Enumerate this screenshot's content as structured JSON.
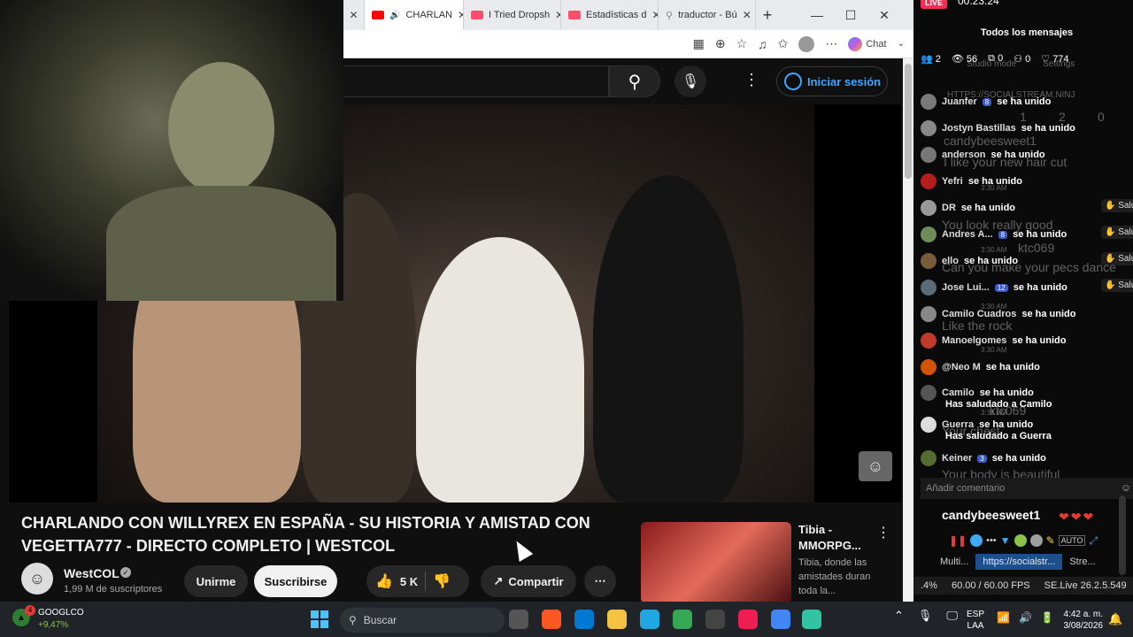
{
  "browser": {
    "tabs": [
      {
        "label": "CHARLAN",
        "color": "#ff0000",
        "active": true
      },
      {
        "label": "I Tried Dropsh",
        "color": "#ff4d6d",
        "active": false
      },
      {
        "label": "Estadísticas d",
        "color": "#ff4d6d",
        "active": false
      },
      {
        "label": "traductor - Bú",
        "color": "#9e9e9e",
        "active": false
      }
    ],
    "new_tab": "+",
    "minimize": "—",
    "maximize": "☐",
    "close": "✕",
    "chat_label": "Chat"
  },
  "youtube": {
    "login_label": "Iniciar sesión",
    "video_title": "CHARLANDO CON WILLYREX EN ESPAÑA - SU HISTORIA Y AMISTAD CON VEGETTA777 - DIRECTO COMPLETO | WESTCOL",
    "channel_name": "WestCOL",
    "subscribers": "1,99 M de suscriptores",
    "join_label": "Unirme",
    "subscribe_label": "Suscribirse",
    "likes": "5 K",
    "share_label": "Compartir",
    "recommended": {
      "title": "Tibia - MMORPG...",
      "description": "Tibia, donde las amistades duran toda la..."
    }
  },
  "tiktok": {
    "live_badge": "LIVE",
    "timer": "00:23:24",
    "header": "Todos los mensajes",
    "stats": {
      "viewers_joined": "2",
      "views": "56",
      "shares": "0",
      "followers": "0",
      "likes": "774"
    },
    "ghost_labels": [
      "Studio mode",
      "Settings"
    ],
    "messages": [
      {
        "user": "Juanfer",
        "badge": "8",
        "action": "se ha unido",
        "color": "#7a7a7a",
        "wave": false
      },
      {
        "user": "Jostyn Bastillas",
        "badge": "",
        "action": "se ha unido",
        "color": "#888",
        "wave": false
      },
      {
        "user": "anderson",
        "badge": "",
        "action": "se ha unido",
        "color": "#777",
        "wave": false
      },
      {
        "user": "Yefri",
        "badge": "",
        "action": "se ha unido",
        "color": "#b71c1c",
        "wave": false
      },
      {
        "user": "DR",
        "badge": "",
        "action": "se ha unido",
        "color": "#999",
        "wave": true
      },
      {
        "user": "Andres A...",
        "badge": "8",
        "action": "se ha unido",
        "color": "#6d8c5a",
        "wave": true
      },
      {
        "user": "ello",
        "badge": "",
        "action": "se ha unido",
        "color": "#7a5c3a",
        "wave": true
      },
      {
        "user": "Jose Lui...",
        "badge": "12",
        "action": "se ha unido",
        "color": "#5c6b7a",
        "wave": true
      },
      {
        "user": "Camilo Cuadros",
        "badge": "",
        "action": "se ha unido",
        "color": "#888",
        "wave": false
      },
      {
        "user": "Manoelgomes",
        "badge": "",
        "action": "se ha unido",
        "color": "#c0392b",
        "wave": false
      },
      {
        "user": "@Neo M",
        "badge": "",
        "action": "se ha unido",
        "color": "#d35400",
        "wave": false
      },
      {
        "user": "Camilo",
        "badge": "",
        "action": "se ha unido",
        "color": "#555",
        "wave": false
      },
      {
        "user": "Guerra",
        "badge": "",
        "action": "se ha unido",
        "color": "#ddd",
        "wave": false
      },
      {
        "user": "Keiner",
        "badge": "3",
        "action": "se ha unido",
        "color": "#556b2f",
        "wave": false
      }
    ],
    "wave_label": "Salud",
    "greetings": [
      "Has saludado a Camilo",
      "Has saludado a Guerra"
    ],
    "overlay_ghost": {
      "url": "HTTPS://SOCIALSTREAM.NINJ",
      "user": "candybeesweet1",
      "texts": [
        "I like your new hair cut",
        "You look really good",
        "Can you make your pecs dance",
        "Like the rock",
        "Your chest",
        "Your body is beautiful"
      ],
      "other_users": [
        "ktc069",
        "ktc069"
      ],
      "times": [
        "3:30 AM",
        "3:30 AM",
        "3:30 AM",
        "3:30 AM",
        "3:31 AM"
      ],
      "counts": [
        "1",
        "2",
        "0"
      ]
    },
    "comment_placeholder": "Añadir comentario",
    "highlight_user": "candybeesweet1",
    "hearts": "❤❤❤",
    "sources": [
      "Multi...",
      "https://socialstr...",
      "Stre..."
    ]
  },
  "obs": {
    "percent": ".4%",
    "fps": "60.00 / 60.00 FPS",
    "version": "SE.Live 26.2.5.549"
  },
  "taskbar": {
    "stock_name": "GOOGLCO",
    "stock_badge": "4",
    "stock_change": "+9,47%",
    "search_placeholder": "Buscar",
    "lang_line1": "ESP",
    "lang_line2": "LAA",
    "time": "4:42 a. m.",
    "date": "3/08/2026",
    "apps": [
      {
        "name": "task-view",
        "color": "#555"
      },
      {
        "name": "brave",
        "color": "#ff5722"
      },
      {
        "name": "store",
        "color": "#0078d4"
      },
      {
        "name": "explorer",
        "color": "#f5c242"
      },
      {
        "name": "edge",
        "color": "#1ea7e1"
      },
      {
        "name": "chrome",
        "color": "#34a853"
      },
      {
        "name": "obs",
        "color": "#444"
      },
      {
        "name": "tiktok",
        "color": "#ee1d52"
      },
      {
        "name": "chrome-profile",
        "color": "#4285f4"
      },
      {
        "name": "streamlabs",
        "color": "#31c3a2"
      }
    ]
  }
}
